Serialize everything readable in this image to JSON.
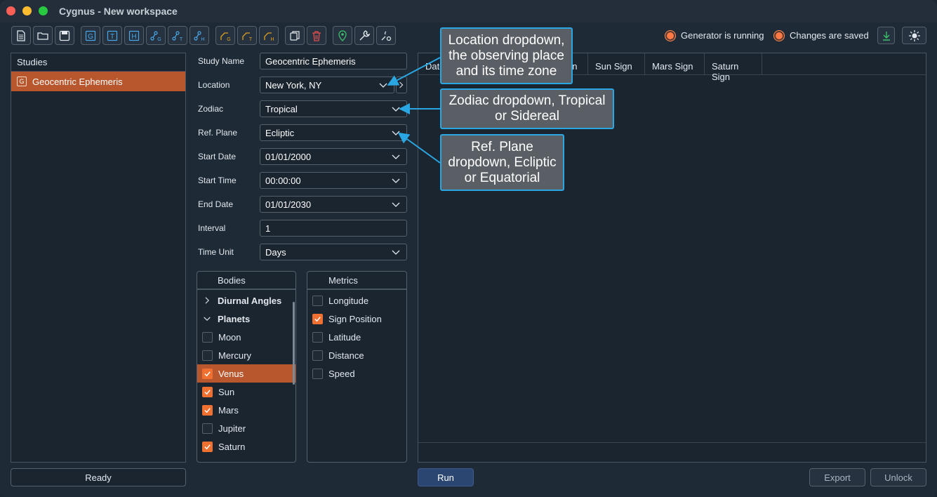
{
  "window": {
    "title": "Cygnus - New workspace"
  },
  "toolbar": {
    "buttons": [
      {
        "name": "new-file-icon",
        "glyph": "doc"
      },
      {
        "name": "open-folder-icon",
        "glyph": "folder"
      },
      {
        "name": "save-icon",
        "glyph": "save"
      },
      {
        "name": "geocentric-study-icon",
        "glyph": "G"
      },
      {
        "name": "topocentric-study-icon",
        "glyph": "T"
      },
      {
        "name": "heliocentric-study-icon",
        "glyph": "H"
      }
    ]
  },
  "status": {
    "generator": "Generator is running",
    "changes": "Changes are saved"
  },
  "studies": {
    "header": "Studies",
    "items": [
      {
        "icon": "G",
        "label": "Geocentric Ephemeris"
      }
    ],
    "ready": "Ready"
  },
  "form": {
    "study_name": {
      "label": "Study Name",
      "value": "Geocentric Ephemeris"
    },
    "location": {
      "label": "Location",
      "value": "New York, NY"
    },
    "zodiac": {
      "label": "Zodiac",
      "value": "Tropical"
    },
    "ref_plane": {
      "label": "Ref. Plane",
      "value": "Ecliptic"
    },
    "start_date": {
      "label": "Start Date",
      "value": "01/01/2000"
    },
    "start_time": {
      "label": "Start Time",
      "value": "00:00:00"
    },
    "end_date": {
      "label": "End Date",
      "value": "01/01/2030"
    },
    "interval": {
      "label": "Interval",
      "value": "1"
    },
    "time_unit": {
      "label": "Time Unit",
      "value": "Days"
    }
  },
  "bodies": {
    "header": "Bodies",
    "groups": {
      "diurnal": "Diurnal Angles",
      "planets": "Planets"
    },
    "items": [
      {
        "label": "Moon",
        "checked": false
      },
      {
        "label": "Mercury",
        "checked": false
      },
      {
        "label": "Venus",
        "checked": true
      },
      {
        "label": "Sun",
        "checked": true
      },
      {
        "label": "Mars",
        "checked": true
      },
      {
        "label": "Jupiter",
        "checked": false
      },
      {
        "label": "Saturn",
        "checked": true
      }
    ]
  },
  "metrics": {
    "header": "Metrics",
    "items": [
      {
        "label": "Longitude",
        "checked": false
      },
      {
        "label": "Sign Position",
        "checked": true
      },
      {
        "label": "Latitude",
        "checked": false
      },
      {
        "label": "Distance",
        "checked": false
      },
      {
        "label": "Speed",
        "checked": false
      }
    ]
  },
  "results": {
    "columns": [
      "Date",
      "gn",
      "Sun Sign",
      "Mars Sign",
      "Saturn Sign"
    ]
  },
  "actions": {
    "run": "Run",
    "export": "Export",
    "unlock": "Unlock"
  },
  "callouts": {
    "location": "Location dropdown, the observing place and its time zone",
    "zodiac": "Zodiac dropdown, Tropical or Sidereal",
    "ref_plane": "Ref. Plane dropdown, Ecliptic or Equatorial"
  },
  "colors": {
    "accent": "#b8572d",
    "checkbox_on": "#f07031",
    "callout_border": "#2aa7e3",
    "run_button": "#2c4672"
  }
}
